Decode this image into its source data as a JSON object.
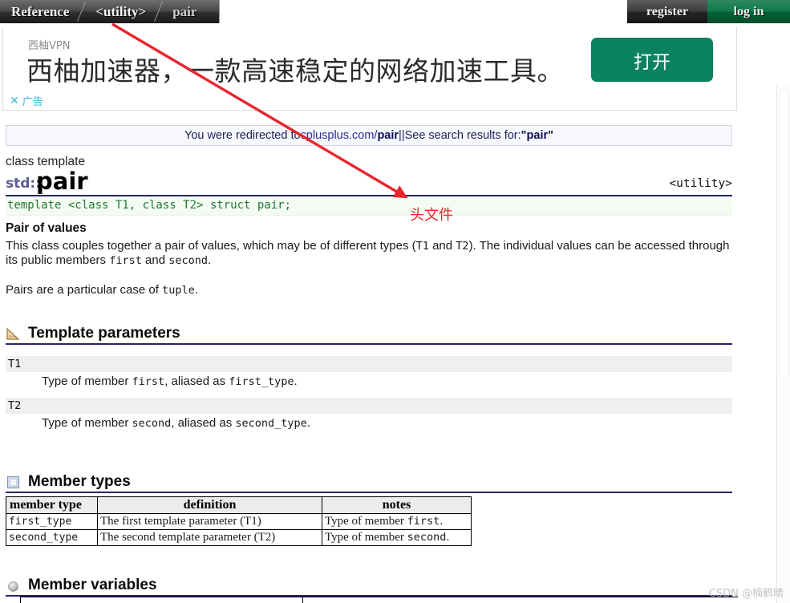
{
  "breadcrumb": {
    "items": [
      {
        "label": "Reference",
        "state": "active"
      },
      {
        "label": "<utility>",
        "state": "active"
      },
      {
        "label": "pair",
        "state": "current"
      }
    ]
  },
  "auth": {
    "register_label": "register",
    "login_label": "log in"
  },
  "ad": {
    "brand": "西柚VPN",
    "headline": "西柚加速器，一款高速稳定的网络加速工具。",
    "cta_label": "打开",
    "close_x": "✕",
    "close_label": "广告"
  },
  "redirect": {
    "prefix": "You were redirected to ",
    "domain": "cplusplus.com/",
    "domain_bold": "pair",
    "separator": " || ",
    "search_prefix": "See search results for: ",
    "search_term": "\"pair\""
  },
  "page": {
    "kind": "class template",
    "namespace": "std::",
    "name": "pair",
    "header": "<utility>",
    "signature": "template <class T1, class T2> struct pair;",
    "subtitle": "Pair of values",
    "paragraph1_a": "This class couples together a pair of values, which may be of different types (",
    "paragraph1_t1": "T1",
    "paragraph1_b": " and ",
    "paragraph1_t2": "T2",
    "paragraph1_c": "). The individual values can be accessed through its public members ",
    "paragraph1_first": "first",
    "paragraph1_d": " and ",
    "paragraph1_second": "second",
    "paragraph1_e": ".",
    "paragraph2_a": "Pairs are a particular case of ",
    "paragraph2_tuple": "tuple",
    "paragraph2_b": "."
  },
  "sections": {
    "template_parameters": {
      "title": "Template parameters",
      "icon": "ruler-icon",
      "params": [
        {
          "key": "T1",
          "desc_a": "Type of member ",
          "desc_mono1": "first",
          "desc_b": ", aliased as ",
          "desc_mono2": "first_type",
          "desc_c": "."
        },
        {
          "key": "T2",
          "desc_a": "Type of member ",
          "desc_mono1": "second",
          "desc_b": ", aliased as ",
          "desc_mono2": "second_type",
          "desc_c": "."
        }
      ]
    },
    "member_types": {
      "title": "Member types",
      "icon": "page-icon",
      "columns": [
        "member type",
        "definition",
        "notes"
      ],
      "rows": [
        {
          "member_type": "first_type",
          "definition": "The first template parameter (T1)",
          "notes_a": "Type of member ",
          "notes_mono": "first",
          "notes_b": "."
        },
        {
          "member_type": "second_type",
          "definition": "The second template parameter (T2)",
          "notes_a": "Type of member ",
          "notes_mono": "second",
          "notes_b": "."
        }
      ]
    },
    "member_variables": {
      "title": "Member variables",
      "icon": "sphere-icon"
    }
  },
  "annotation": {
    "label": "头文件",
    "color": "#e8262d",
    "arrow_from": "140,30",
    "arrow_to": "505,245"
  },
  "watermark": {
    "text": "CSDN @楠鹤晴"
  },
  "colors": {
    "accent_green": "#0b8260",
    "rule_navy": "#26266b",
    "code_green": "#1f7a33",
    "annotation_red": "#e8262d",
    "ad_close_blue": "#3bb7dd"
  }
}
